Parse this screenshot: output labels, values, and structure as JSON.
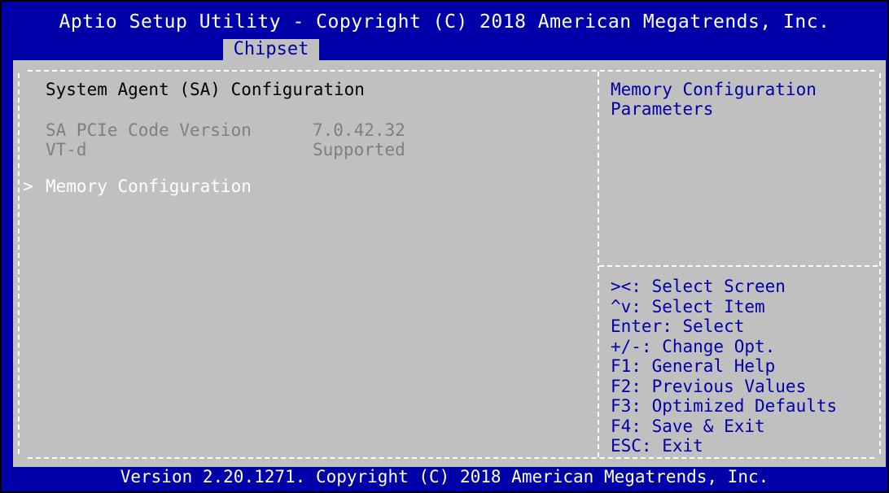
{
  "header": {
    "title": "Aptio Setup Utility - Copyright (C) 2018 American Megatrends, Inc.",
    "active_tab": "Chipset"
  },
  "main": {
    "title": "System Agent (SA) Configuration",
    "info_rows": [
      {
        "label": "SA PCIe Code Version",
        "value": "7.0.42.32"
      },
      {
        "label": "VT-d",
        "value": "Supported"
      }
    ],
    "menu_items": [
      {
        "arrow": ">",
        "label": "Memory Configuration",
        "selected": true
      }
    ]
  },
  "help": {
    "text": "Memory Configuration Parameters"
  },
  "keys": [
    "><: Select Screen",
    "^v: Select Item",
    "Enter: Select",
    "+/-: Change Opt.",
    "F1: General Help",
    "F2: Previous Values",
    "F3: Optimized Defaults",
    "F4: Save & Exit",
    "ESC: Exit"
  ],
  "footer": {
    "text": "Version 2.20.1271. Copyright (C) 2018 American Megatrends, Inc."
  },
  "colors": {
    "background": "#0000a8",
    "panel": "#c0c0c0",
    "highlight_text": "#ffffff",
    "disabled_text": "#7f7f7f",
    "help_text": "#0000a8"
  }
}
